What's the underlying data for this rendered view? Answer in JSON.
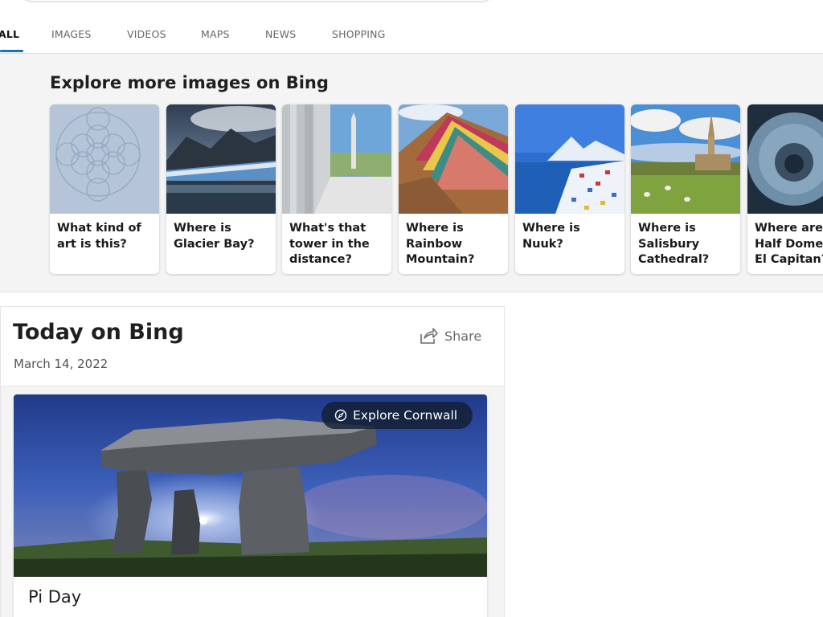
{
  "tabs": [
    {
      "label": "ALL"
    },
    {
      "label": "IMAGES"
    },
    {
      "label": "VIDEOS"
    },
    {
      "label": "MAPS"
    },
    {
      "label": "NEWS"
    },
    {
      "label": "SHOPPING"
    }
  ],
  "explore": {
    "title": "Explore more images on Bing",
    "cards": [
      {
        "caption": "What kind of art is this?"
      },
      {
        "caption": "Where is Glacier Bay?"
      },
      {
        "caption": "What's that tower in the distance?"
      },
      {
        "caption": "Where is Rainbow Mountain?"
      },
      {
        "caption": "Where is Nuuk?"
      },
      {
        "caption": "Where is Salisbury Cathedral?"
      },
      {
        "caption": "Where are Half Dome and El Capitan?"
      }
    ]
  },
  "today": {
    "title": "Today on Bing",
    "date": "March 14, 2022",
    "share_label": "Share",
    "explore_pill_label": "Explore Cornwall",
    "feature_title": "Pi Day"
  },
  "colors": {
    "accent": "#1a73b8",
    "band_bg": "#f4f4f4"
  },
  "icons": {
    "share": "share-icon",
    "compass": "compass-icon"
  }
}
